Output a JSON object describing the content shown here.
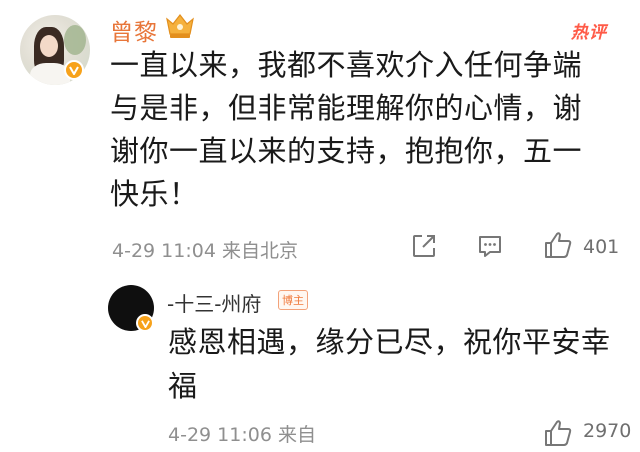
{
  "comment": {
    "author": "曾黎",
    "hot_label": "热评",
    "text": "一直以来，我都不喜欢介入任何争端与是非，但非常能理解你的心情，谢谢你一直以来的支持，抱抱你，五一快乐！",
    "time": "4-29 11:04",
    "location": "来自北京",
    "time_location": "4-29 11:04  来自北京",
    "likes": "401",
    "accent_color": "#e8763a",
    "hot_color": "#ff5a47"
  },
  "reply": {
    "author": "-十三-州府",
    "author_badge": "博主",
    "text": "感恩相遇，缘分已尽，祝你平安幸福",
    "meta": "4-29 11:06  来自",
    "likes": "2970"
  },
  "icons": {
    "vip": "vip-badge-icon",
    "verified": "verified-v-icon",
    "share": "share-icon",
    "reply": "comment-icon",
    "like": "thumbs-up-icon"
  }
}
